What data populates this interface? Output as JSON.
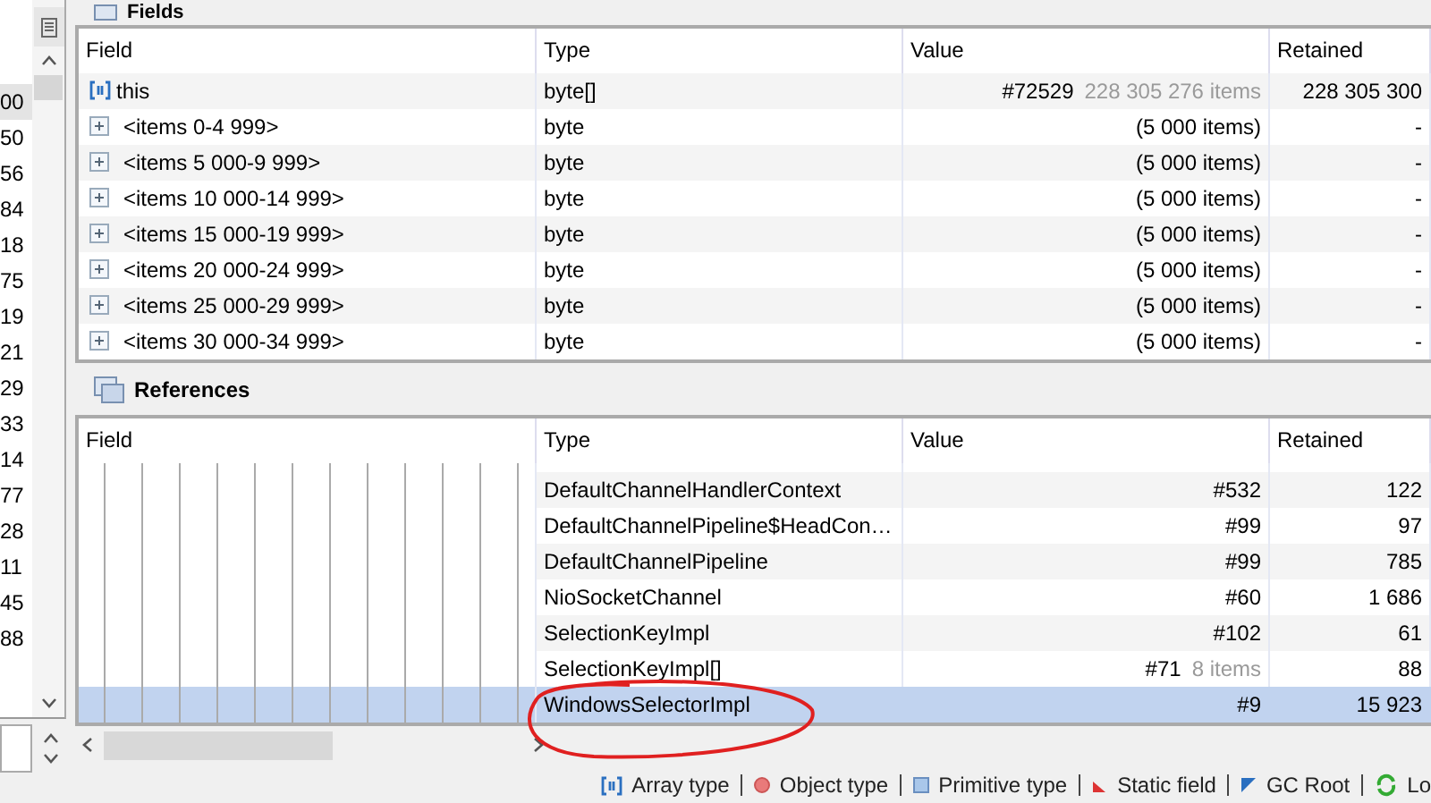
{
  "left_list": {
    "rows": [
      {
        "text": "00",
        "selected": true
      },
      {
        "text": "50",
        "selected": false
      },
      {
        "text": "56",
        "selected": false
      },
      {
        "text": "84",
        "selected": false
      },
      {
        "text": "18",
        "selected": false
      },
      {
        "text": "75",
        "selected": false
      },
      {
        "text": "19",
        "selected": false
      },
      {
        "text": "21",
        "selected": false
      },
      {
        "text": "29",
        "selected": false
      },
      {
        "text": "33",
        "selected": false
      },
      {
        "text": "14",
        "selected": false
      },
      {
        "text": "77",
        "selected": false
      },
      {
        "text": "28",
        "selected": false
      },
      {
        "text": "11",
        "selected": false
      },
      {
        "text": "45",
        "selected": false
      },
      {
        "text": "88",
        "selected": false
      }
    ]
  },
  "fields": {
    "title": "Fields",
    "columns": [
      "Field",
      "Type",
      "Value",
      "Retained"
    ],
    "rows": [
      {
        "kind": "array",
        "field": "this",
        "type": "byte[]",
        "value": "#72529",
        "value_note": "228 305 276 items",
        "retained": "228 305 300"
      },
      {
        "kind": "group",
        "field": "<items 0-4 999>",
        "type": "byte",
        "value": "(5 000 items)",
        "retained": "-"
      },
      {
        "kind": "group",
        "field": "<items 5 000-9 999>",
        "type": "byte",
        "value": "(5 000 items)",
        "retained": "-"
      },
      {
        "kind": "group",
        "field": "<items 10 000-14 999>",
        "type": "byte",
        "value": "(5 000 items)",
        "retained": "-"
      },
      {
        "kind": "group",
        "field": "<items 15 000-19 999>",
        "type": "byte",
        "value": "(5 000 items)",
        "retained": "-"
      },
      {
        "kind": "group",
        "field": "<items 20 000-24 999>",
        "type": "byte",
        "value": "(5 000 items)",
        "retained": "-"
      },
      {
        "kind": "group",
        "field": "<items 25 000-29 999>",
        "type": "byte",
        "value": "(5 000 items)",
        "retained": "-"
      },
      {
        "kind": "group",
        "field": "<items 30 000-34 999>",
        "type": "byte",
        "value": "(5 000 items)",
        "retained": "-"
      }
    ]
  },
  "references": {
    "title": "References",
    "columns": [
      "Field",
      "Type",
      "Value",
      "Retained"
    ],
    "rows": [
      {
        "type": "DefaultChannelHandlerContext",
        "value": "#532",
        "retained": "122",
        "selected": false
      },
      {
        "type": "DefaultChannelPipeline$HeadCon…",
        "value": "#99",
        "retained": "97",
        "selected": false
      },
      {
        "type": "DefaultChannelPipeline",
        "value": "#99",
        "retained": "785",
        "selected": false
      },
      {
        "type": "NioSocketChannel",
        "value": "#60",
        "retained": "1 686",
        "selected": false
      },
      {
        "type": "SelectionKeyImpl",
        "value": "#102",
        "retained": "61",
        "selected": false
      },
      {
        "type": "SelectionKeyImpl[]",
        "value": "#71",
        "value_note": "8 items",
        "retained": "88",
        "selected": false
      },
      {
        "type": "WindowsSelectorImpl",
        "value": "#9",
        "retained": "15 923",
        "selected": true
      }
    ]
  },
  "legend": [
    {
      "kind": "array",
      "label": "Array type"
    },
    {
      "kind": "object",
      "label": "Object type"
    },
    {
      "kind": "primitive",
      "label": "Primitive type"
    },
    {
      "kind": "static",
      "label": "Static field"
    },
    {
      "kind": "gcroot",
      "label": "GC Root"
    },
    {
      "kind": "loop",
      "label": "Lo"
    }
  ]
}
